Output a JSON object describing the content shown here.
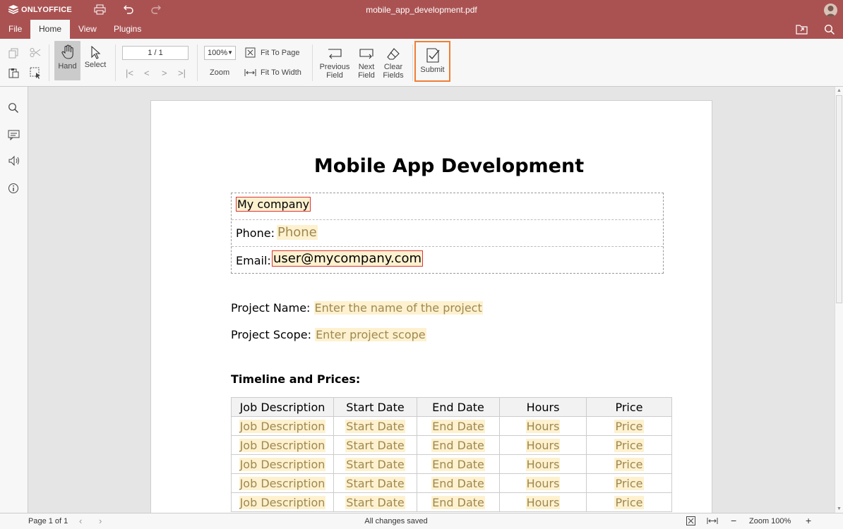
{
  "app": {
    "logo": "ONLYOFFICE",
    "doc_title": "mobile_app_development.pdf"
  },
  "menu": {
    "tabs": [
      "File",
      "Home",
      "View",
      "Plugins"
    ],
    "active": "Home"
  },
  "toolbar": {
    "hand_label": "Hand",
    "select_label": "Select",
    "page_value": "1 / 1",
    "zoom_value": "100%",
    "zoom_label": "Zoom",
    "fit_page_label": "Fit To Page",
    "fit_width_label": "Fit To Width",
    "prev_field_line1": "Previous",
    "prev_field_line2": "Field",
    "next_field_line1": "Next",
    "next_field_line2": "Field",
    "clear_fields_line1": "Clear",
    "clear_fields_line2": "Fields",
    "submit_label": "Submit",
    "accent_color": "#f07e33"
  },
  "document": {
    "heading": "Mobile App Development",
    "company": {
      "value": "My company"
    },
    "phone": {
      "label": "Phone:",
      "placeholder": "Phone"
    },
    "email": {
      "label": "Email:",
      "value": "user@mycompany.com"
    },
    "project_name": {
      "label": "Project Name:",
      "placeholder": "Enter the name of the project"
    },
    "project_scope": {
      "label": "Project Scope:",
      "placeholder": "Enter project scope"
    },
    "timeline_heading": "Timeline and Prices:",
    "table": {
      "headers": [
        "Job Description",
        "Start Date",
        "End Date",
        "Hours",
        "Price"
      ],
      "rows": [
        [
          "Job Description",
          "Start Date",
          "End Date",
          "Hours",
          "Price"
        ],
        [
          "Job Description",
          "Start Date",
          "End Date",
          "Hours",
          "Price"
        ],
        [
          "Job Description",
          "Start Date",
          "End Date",
          "Hours",
          "Price"
        ],
        [
          "Job Description",
          "Start Date",
          "End Date",
          "Hours",
          "Price"
        ],
        [
          "Job Description",
          "Start Date",
          "End Date",
          "Hours",
          "Price"
        ]
      ]
    }
  },
  "status": {
    "page": "Page 1 of 1",
    "saved": "All changes saved",
    "zoom": "Zoom 100%"
  },
  "colors": {
    "brand": "#aa5252",
    "field_bg": "#fdf1cf"
  }
}
